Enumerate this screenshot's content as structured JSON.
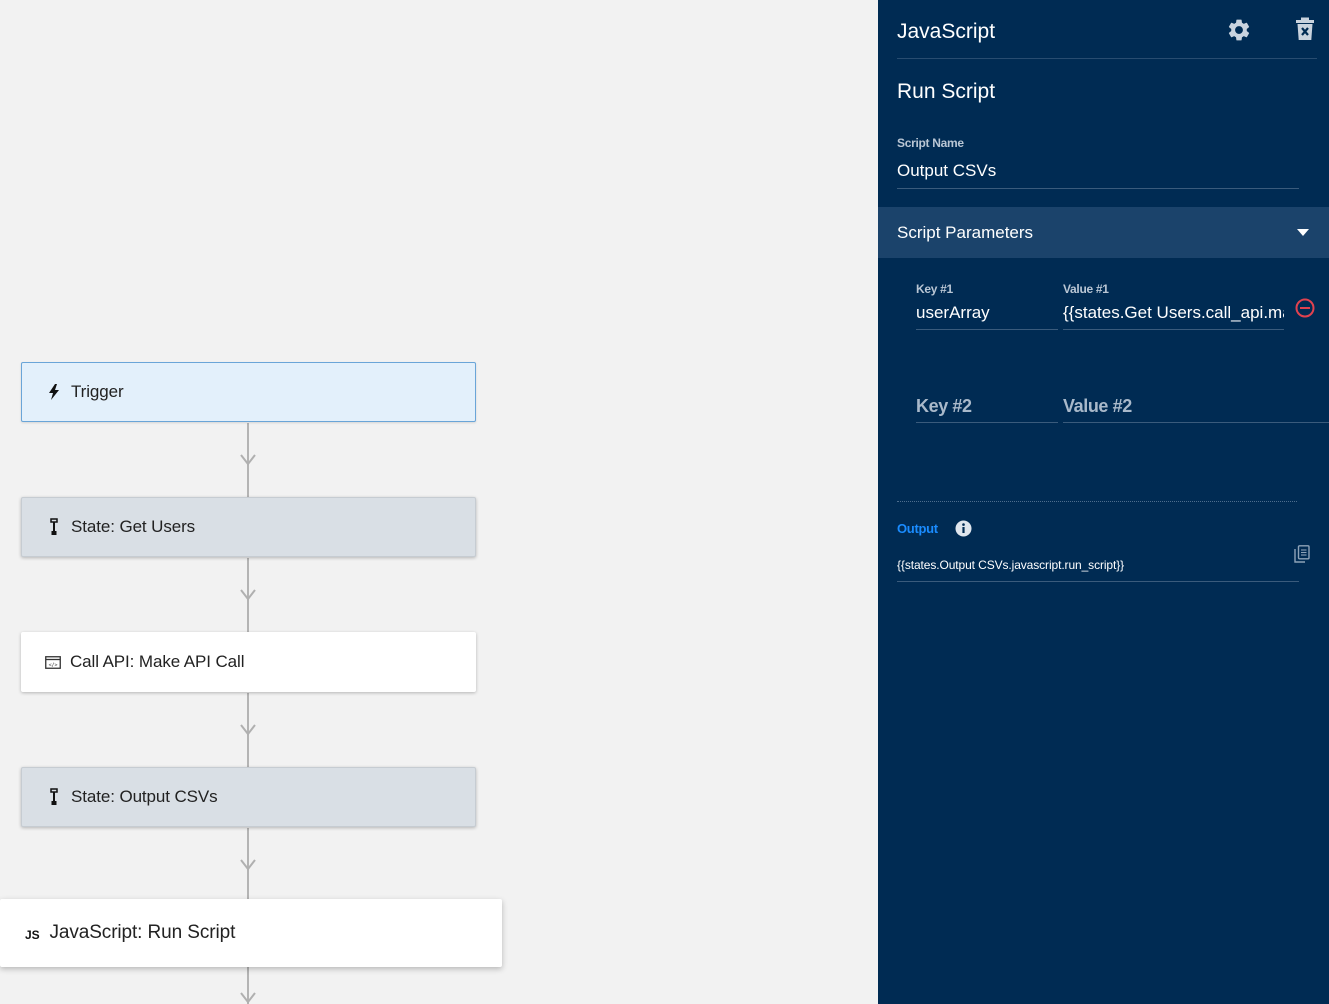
{
  "flow": {
    "nodes": [
      {
        "kind": "trigger",
        "icon": "lightning-icon",
        "label": "Trigger"
      },
      {
        "kind": "state",
        "icon": "state-marker-icon",
        "label": "State: Get Users"
      },
      {
        "kind": "action",
        "icon": "api-window-icon",
        "label": "Call API: Make API Call"
      },
      {
        "kind": "state",
        "icon": "state-marker-icon",
        "label": "State: Output CSVs"
      },
      {
        "kind": "action",
        "icon": "js-icon",
        "badge": "JS",
        "label": "JavaScript: Run Script"
      }
    ]
  },
  "panel": {
    "title": "JavaScript",
    "section_title": "Run Script",
    "script_name": {
      "label": "Script Name",
      "value": "Output CSVs"
    },
    "params": {
      "title": "Script Parameters",
      "rows": [
        {
          "key_label": "Key #1",
          "key_value": "userArray",
          "value_label": "Value #1",
          "value_value": "{{states.Get Users.call_api.ma"
        },
        {
          "key_placeholder": "Key #2",
          "value_placeholder": "Value #2"
        }
      ]
    },
    "output": {
      "label": "Output",
      "value": "{{states.Output CSVs.javascript.run_script}}"
    }
  },
  "colors": {
    "panel_bg": "#002b53",
    "params_bar_bg": "#1b436b",
    "trigger_bg": "#e3f0fb",
    "state_bg": "#d9dfe5",
    "output_label": "#1a8cff",
    "remove_red": "#e0424f"
  }
}
